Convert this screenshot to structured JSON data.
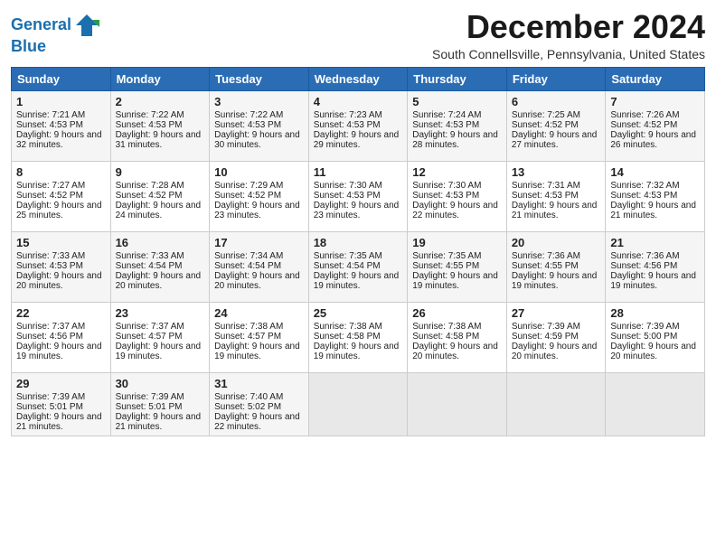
{
  "logo": {
    "line1": "General",
    "line2": "Blue"
  },
  "title": "December 2024",
  "location": "South Connellsville, Pennsylvania, United States",
  "days_header": [
    "Sunday",
    "Monday",
    "Tuesday",
    "Wednesday",
    "Thursday",
    "Friday",
    "Saturday"
  ],
  "weeks": [
    [
      {
        "day": "1",
        "sunrise": "Sunrise: 7:21 AM",
        "sunset": "Sunset: 4:53 PM",
        "daylight": "Daylight: 9 hours and 32 minutes."
      },
      {
        "day": "2",
        "sunrise": "Sunrise: 7:22 AM",
        "sunset": "Sunset: 4:53 PM",
        "daylight": "Daylight: 9 hours and 31 minutes."
      },
      {
        "day": "3",
        "sunrise": "Sunrise: 7:22 AM",
        "sunset": "Sunset: 4:53 PM",
        "daylight": "Daylight: 9 hours and 30 minutes."
      },
      {
        "day": "4",
        "sunrise": "Sunrise: 7:23 AM",
        "sunset": "Sunset: 4:53 PM",
        "daylight": "Daylight: 9 hours and 29 minutes."
      },
      {
        "day": "5",
        "sunrise": "Sunrise: 7:24 AM",
        "sunset": "Sunset: 4:53 PM",
        "daylight": "Daylight: 9 hours and 28 minutes."
      },
      {
        "day": "6",
        "sunrise": "Sunrise: 7:25 AM",
        "sunset": "Sunset: 4:52 PM",
        "daylight": "Daylight: 9 hours and 27 minutes."
      },
      {
        "day": "7",
        "sunrise": "Sunrise: 7:26 AM",
        "sunset": "Sunset: 4:52 PM",
        "daylight": "Daylight: 9 hours and 26 minutes."
      }
    ],
    [
      {
        "day": "8",
        "sunrise": "Sunrise: 7:27 AM",
        "sunset": "Sunset: 4:52 PM",
        "daylight": "Daylight: 9 hours and 25 minutes."
      },
      {
        "day": "9",
        "sunrise": "Sunrise: 7:28 AM",
        "sunset": "Sunset: 4:52 PM",
        "daylight": "Daylight: 9 hours and 24 minutes."
      },
      {
        "day": "10",
        "sunrise": "Sunrise: 7:29 AM",
        "sunset": "Sunset: 4:52 PM",
        "daylight": "Daylight: 9 hours and 23 minutes."
      },
      {
        "day": "11",
        "sunrise": "Sunrise: 7:30 AM",
        "sunset": "Sunset: 4:53 PM",
        "daylight": "Daylight: 9 hours and 23 minutes."
      },
      {
        "day": "12",
        "sunrise": "Sunrise: 7:30 AM",
        "sunset": "Sunset: 4:53 PM",
        "daylight": "Daylight: 9 hours and 22 minutes."
      },
      {
        "day": "13",
        "sunrise": "Sunrise: 7:31 AM",
        "sunset": "Sunset: 4:53 PM",
        "daylight": "Daylight: 9 hours and 21 minutes."
      },
      {
        "day": "14",
        "sunrise": "Sunrise: 7:32 AM",
        "sunset": "Sunset: 4:53 PM",
        "daylight": "Daylight: 9 hours and 21 minutes."
      }
    ],
    [
      {
        "day": "15",
        "sunrise": "Sunrise: 7:33 AM",
        "sunset": "Sunset: 4:53 PM",
        "daylight": "Daylight: 9 hours and 20 minutes."
      },
      {
        "day": "16",
        "sunrise": "Sunrise: 7:33 AM",
        "sunset": "Sunset: 4:54 PM",
        "daylight": "Daylight: 9 hours and 20 minutes."
      },
      {
        "day": "17",
        "sunrise": "Sunrise: 7:34 AM",
        "sunset": "Sunset: 4:54 PM",
        "daylight": "Daylight: 9 hours and 20 minutes."
      },
      {
        "day": "18",
        "sunrise": "Sunrise: 7:35 AM",
        "sunset": "Sunset: 4:54 PM",
        "daylight": "Daylight: 9 hours and 19 minutes."
      },
      {
        "day": "19",
        "sunrise": "Sunrise: 7:35 AM",
        "sunset": "Sunset: 4:55 PM",
        "daylight": "Daylight: 9 hours and 19 minutes."
      },
      {
        "day": "20",
        "sunrise": "Sunrise: 7:36 AM",
        "sunset": "Sunset: 4:55 PM",
        "daylight": "Daylight: 9 hours and 19 minutes."
      },
      {
        "day": "21",
        "sunrise": "Sunrise: 7:36 AM",
        "sunset": "Sunset: 4:56 PM",
        "daylight": "Daylight: 9 hours and 19 minutes."
      }
    ],
    [
      {
        "day": "22",
        "sunrise": "Sunrise: 7:37 AM",
        "sunset": "Sunset: 4:56 PM",
        "daylight": "Daylight: 9 hours and 19 minutes."
      },
      {
        "day": "23",
        "sunrise": "Sunrise: 7:37 AM",
        "sunset": "Sunset: 4:57 PM",
        "daylight": "Daylight: 9 hours and 19 minutes."
      },
      {
        "day": "24",
        "sunrise": "Sunrise: 7:38 AM",
        "sunset": "Sunset: 4:57 PM",
        "daylight": "Daylight: 9 hours and 19 minutes."
      },
      {
        "day": "25",
        "sunrise": "Sunrise: 7:38 AM",
        "sunset": "Sunset: 4:58 PM",
        "daylight": "Daylight: 9 hours and 19 minutes."
      },
      {
        "day": "26",
        "sunrise": "Sunrise: 7:38 AM",
        "sunset": "Sunset: 4:58 PM",
        "daylight": "Daylight: 9 hours and 20 minutes."
      },
      {
        "day": "27",
        "sunrise": "Sunrise: 7:39 AM",
        "sunset": "Sunset: 4:59 PM",
        "daylight": "Daylight: 9 hours and 20 minutes."
      },
      {
        "day": "28",
        "sunrise": "Sunrise: 7:39 AM",
        "sunset": "Sunset: 5:00 PM",
        "daylight": "Daylight: 9 hours and 20 minutes."
      }
    ],
    [
      {
        "day": "29",
        "sunrise": "Sunrise: 7:39 AM",
        "sunset": "Sunset: 5:01 PM",
        "daylight": "Daylight: 9 hours and 21 minutes."
      },
      {
        "day": "30",
        "sunrise": "Sunrise: 7:39 AM",
        "sunset": "Sunset: 5:01 PM",
        "daylight": "Daylight: 9 hours and 21 minutes."
      },
      {
        "day": "31",
        "sunrise": "Sunrise: 7:40 AM",
        "sunset": "Sunset: 5:02 PM",
        "daylight": "Daylight: 9 hours and 22 minutes."
      },
      null,
      null,
      null,
      null
    ]
  ]
}
